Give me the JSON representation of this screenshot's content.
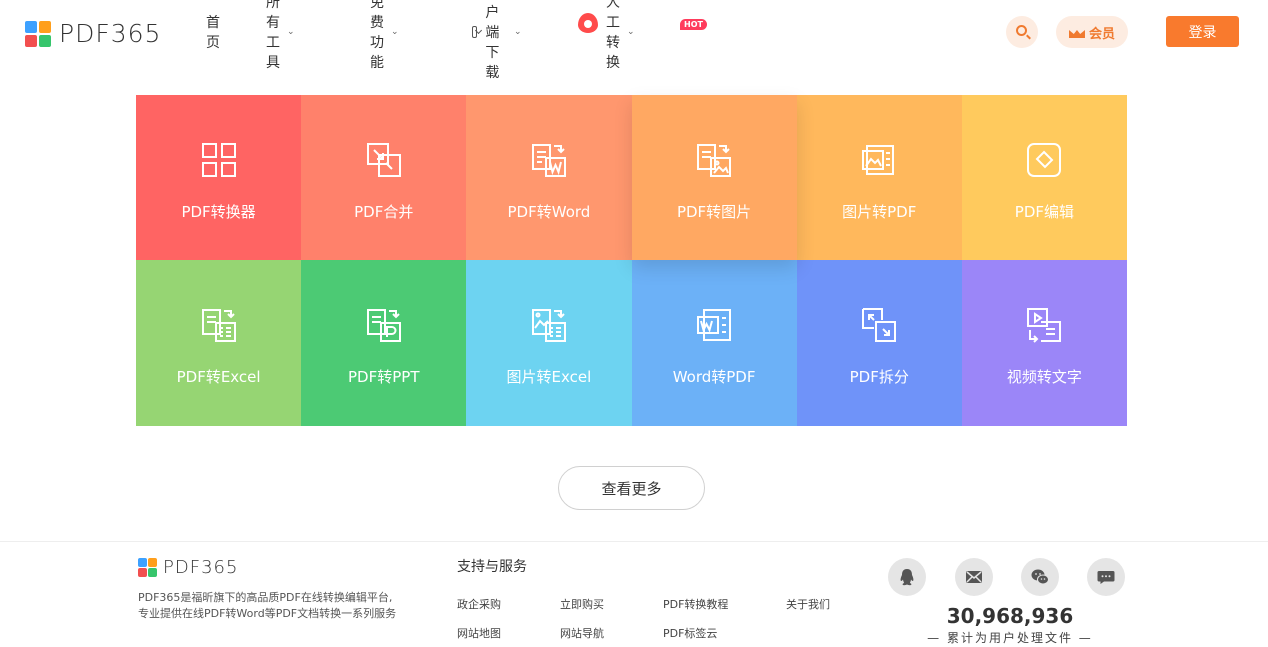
{
  "brand": {
    "name": "PDF365"
  },
  "nav": {
    "items": [
      {
        "label": "首页"
      },
      {
        "label": "所有工具"
      },
      {
        "label": "免费功能"
      },
      {
        "label": "客户端下载"
      },
      {
        "label": "人工转换"
      }
    ],
    "hot_badge": "HOT"
  },
  "header": {
    "vip_label": "会员",
    "login_label": "登录"
  },
  "tools": [
    {
      "label": "PDF转换器",
      "color": "#ff6463",
      "icon": "grid-icon"
    },
    {
      "label": "PDF合并",
      "color": "#ff816b",
      "icon": "merge-icon"
    },
    {
      "label": "PDF转Word",
      "color": "#ff976e",
      "icon": "pdf-to-word-icon"
    },
    {
      "label": "PDF转图片",
      "color": "#ffa862",
      "icon": "pdf-to-image-icon"
    },
    {
      "label": "图片转PDF",
      "color": "#ffb85c",
      "icon": "image-to-pdf-icon"
    },
    {
      "label": "PDF编辑",
      "color": "#ffca5d",
      "icon": "edit-icon"
    },
    {
      "label": "PDF转Excel",
      "color": "#96d573",
      "icon": "pdf-to-excel-icon"
    },
    {
      "label": "PDF转PPT",
      "color": "#4cca74",
      "icon": "pdf-to-ppt-icon"
    },
    {
      "label": "图片转Excel",
      "color": "#6dd3f1",
      "icon": "image-to-excel-icon"
    },
    {
      "label": "Word转PDF",
      "color": "#6cb1f7",
      "icon": "word-to-pdf-icon"
    },
    {
      "label": "PDF拆分",
      "color": "#6f93f9",
      "icon": "split-icon"
    },
    {
      "label": "视频转文字",
      "color": "#9b86f8",
      "icon": "video-to-text-icon"
    }
  ],
  "more_label": "查看更多",
  "footer": {
    "brand": "PDF365",
    "desc_line1": "PDF365是福昕旗下的高品质PDF在线转换编辑平台,",
    "desc_line2": "专业提供在线PDF转Word等PDF文档转换一系列服务",
    "heading": "支持与服务",
    "links": [
      "政企采购",
      "立即购买",
      "PDF转换教程",
      "关于我们",
      "网站地图",
      "网站导航",
      "PDF标签云"
    ],
    "count": "30,968,936",
    "count_label": "— 累计为用户处理文件 —"
  }
}
